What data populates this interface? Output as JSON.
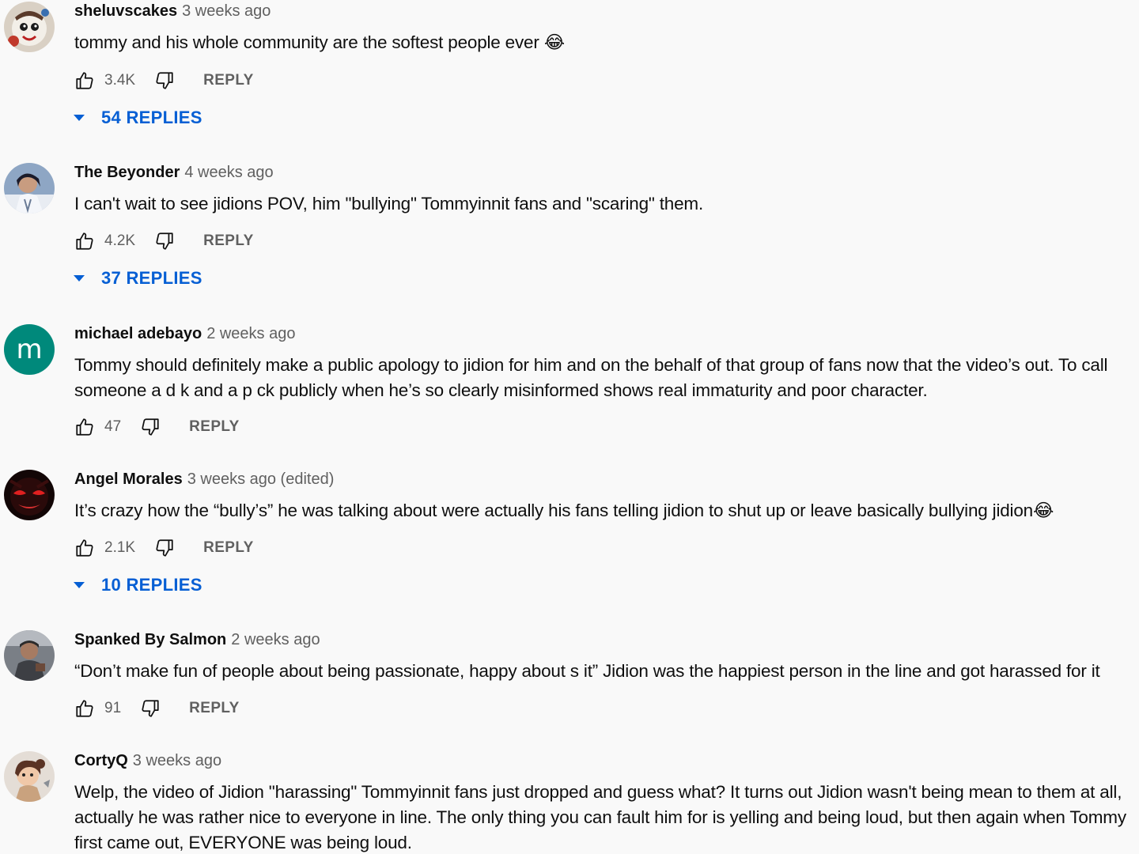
{
  "comments": [
    {
      "author": "sheluvscakes",
      "time": "3 weeks ago",
      "text": "tommy and his whole community are the softest people ever 😂",
      "likes": "3.4K",
      "reply_label": "REPLY",
      "replies_label": "54 REPLIES"
    },
    {
      "author": "The Beyonder",
      "time": "4 weeks ago",
      "text": "I can't wait to see jidions POV, him \"bullying\" Tommyinnit fans and \"scaring\" them.",
      "likes": "4.2K",
      "reply_label": "REPLY",
      "replies_label": "37 REPLIES"
    },
    {
      "author": "michael adebayo",
      "avatar_letter": "m",
      "avatar_color": "#00897b",
      "time": "2 weeks ago",
      "text": "Tommy should definitely make a public apology to jidion for him and on the behalf of that group of fans now that the video’s out. To call someone a d  k and a p  ck publicly when he’s so clearly misinformed shows real immaturity and poor character.",
      "likes": "47",
      "reply_label": "REPLY"
    },
    {
      "author": "Angel Morales",
      "time": "3 weeks ago (edited)",
      "text": "It’s crazy how the “bully’s” he was talking about were actually his fans telling jidion to shut up or leave basically bullying jidion😂",
      "likes": "2.1K",
      "reply_label": "REPLY",
      "replies_label": "10 REPLIES"
    },
    {
      "author": "Spanked By Salmon",
      "time": "2 weeks ago",
      "text": "“Don’t make fun of people about being passionate, happy about s  it” Jidion was the  happiest person in the line and got harassed for it",
      "likes": "91",
      "reply_label": "REPLY"
    },
    {
      "author": "CortyQ",
      "time": "3 weeks ago",
      "text": "Welp, the video of Jidion \"harassing\" Tommyinnit fans just dropped and guess what? It turns out Jidion wasn't being mean to them at all, actually he was rather nice to everyone in line. The only thing you can fault him for is yelling and being loud, but then again when Tommy first came out, EVERYONE was being loud."
    }
  ],
  "colors": {
    "background": "#f9f9f9",
    "link_blue": "#065fd4",
    "meta_gray": "#606060"
  }
}
